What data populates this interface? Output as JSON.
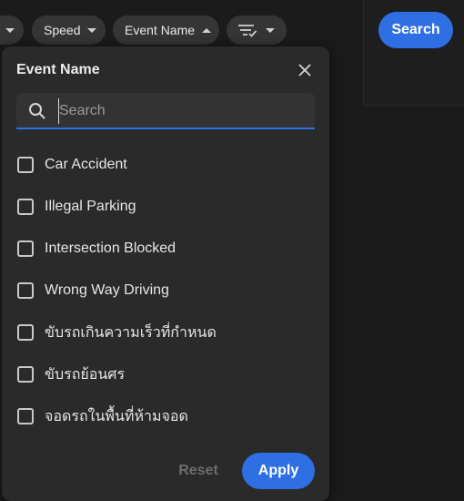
{
  "toolbar": {
    "chips": [
      {
        "label": ""
      },
      {
        "label": "Speed"
      },
      {
        "label": "Event Name"
      },
      {
        "label": ""
      }
    ],
    "search_button": "Search"
  },
  "popup": {
    "title": "Event Name",
    "search_placeholder": "Search",
    "search_value": "",
    "options": [
      {
        "label": "Car Accident",
        "checked": false
      },
      {
        "label": "Illegal Parking",
        "checked": false
      },
      {
        "label": "Intersection Blocked",
        "checked": false
      },
      {
        "label": "Wrong Way Driving",
        "checked": false
      },
      {
        "label": "ขับรถเกินความเร็วที่กำหนด",
        "checked": false
      },
      {
        "label": "ขับรถย้อนศร",
        "checked": false
      },
      {
        "label": "จอดรถในพื้นที่ห้ามจอด",
        "checked": false
      }
    ],
    "reset_label": "Reset",
    "apply_label": "Apply"
  },
  "colors": {
    "accent": "#2f6fe4",
    "background": "#1b1b1b",
    "popup_background": "#2a2a2a",
    "chip_background": "#353535"
  }
}
